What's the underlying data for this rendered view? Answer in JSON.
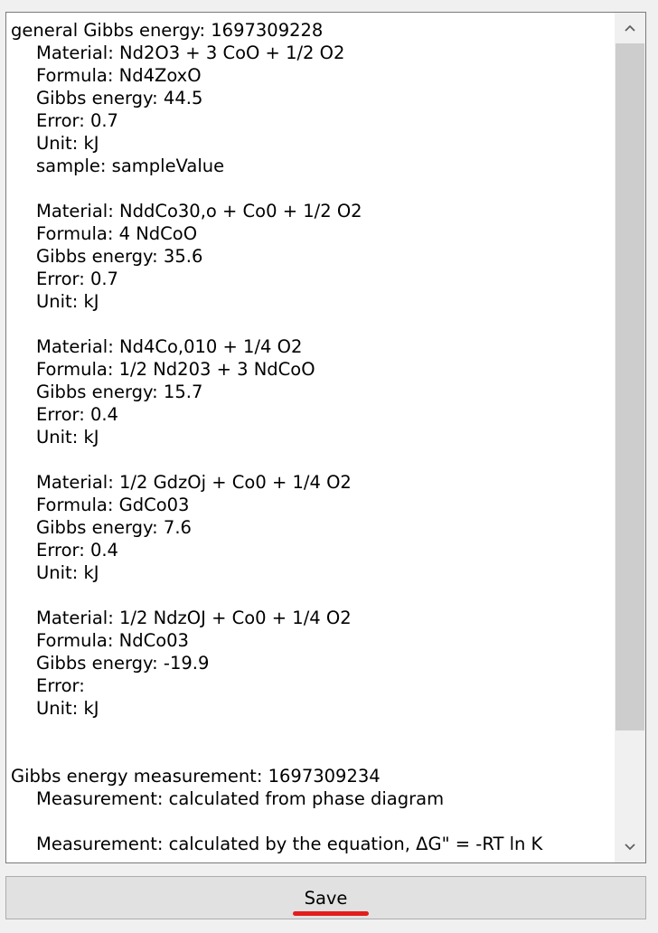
{
  "text_area": {
    "lines": [
      {
        "text": "general Gibbs energy: 1697309228",
        "indent": false
      },
      {
        "text": "Material: Nd2O3 + 3 CoO + 1/2 O2",
        "indent": true
      },
      {
        "text": "Formula: Nd4ZoxO",
        "indent": true
      },
      {
        "text": "Gibbs energy: 44.5",
        "indent": true
      },
      {
        "text": "Error: 0.7",
        "indent": true
      },
      {
        "text": "Unit: kJ",
        "indent": true
      },
      {
        "text": "sample: sampleValue",
        "indent": true
      },
      {
        "text": "",
        "indent": true
      },
      {
        "text": "Material: NddCo30,o + Co0 + 1/2 O2",
        "indent": true
      },
      {
        "text": "Formula: 4 NdCoO",
        "indent": true
      },
      {
        "text": "Gibbs energy: 35.6",
        "indent": true
      },
      {
        "text": "Error: 0.7",
        "indent": true
      },
      {
        "text": "Unit: kJ",
        "indent": true
      },
      {
        "text": "",
        "indent": true
      },
      {
        "text": "Material: Nd4Co,010 + 1/4 O2",
        "indent": true
      },
      {
        "text": "Formula: 1/2 Nd203 + 3 NdCoO",
        "indent": true
      },
      {
        "text": "Gibbs energy: 15.7",
        "indent": true
      },
      {
        "text": "Error: 0.4",
        "indent": true
      },
      {
        "text": "Unit: kJ",
        "indent": true
      },
      {
        "text": "",
        "indent": true
      },
      {
        "text": "Material: 1/2 GdzOj + Co0 + 1/4 O2",
        "indent": true
      },
      {
        "text": "Formula: GdCo03",
        "indent": true
      },
      {
        "text": "Gibbs energy: 7.6",
        "indent": true
      },
      {
        "text": "Error: 0.4",
        "indent": true
      },
      {
        "text": "Unit: kJ",
        "indent": true
      },
      {
        "text": "",
        "indent": true
      },
      {
        "text": "Material: 1/2 NdzOJ + Co0 + 1/4 O2",
        "indent": true
      },
      {
        "text": "Formula: NdCo03",
        "indent": true
      },
      {
        "text": "Gibbs energy: -19.9",
        "indent": true
      },
      {
        "text": "Error:",
        "indent": true
      },
      {
        "text": "Unit: kJ",
        "indent": true
      },
      {
        "text": "",
        "indent": true
      },
      {
        "text": "",
        "indent": false
      },
      {
        "text": "Gibbs energy measurement: 1697309234",
        "indent": false
      },
      {
        "text": "Measurement: calculated from phase diagram",
        "indent": true
      },
      {
        "text": "",
        "indent": true
      },
      {
        "text": "Measurement: calculated by the equation, ΔG\" = -RT ln K",
        "indent": true
      }
    ]
  },
  "save_button": {
    "label": "Save"
  },
  "icons": {
    "scroll_up": "chevron-up-icon",
    "scroll_down": "chevron-down-icon"
  },
  "colors": {
    "underline_accent": "#e31c1c"
  }
}
